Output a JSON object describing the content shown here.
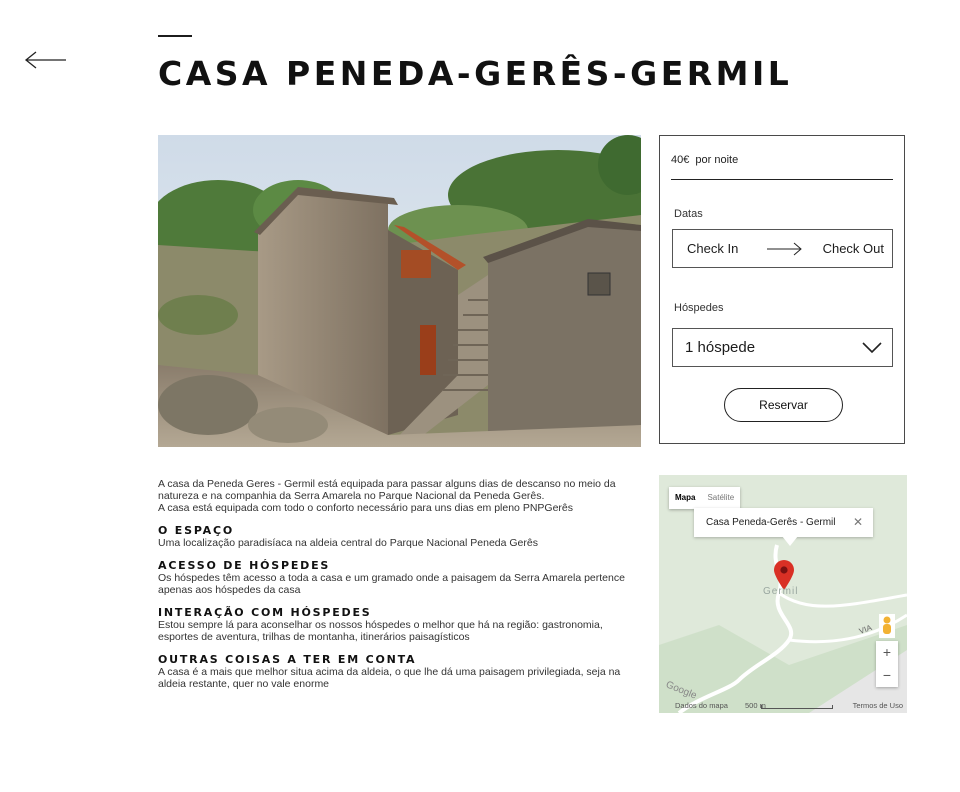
{
  "header": {
    "title": "CASA PENEDA-GERÊS-GERMIL"
  },
  "booking": {
    "price": "40€",
    "price_suffix": "por noite",
    "dates_label": "Datas",
    "check_in": "Check In",
    "check_out": "Check Out",
    "guests_label": "Hóspedes",
    "guests_value": "1 hóspede",
    "reserve_label": "Reservar"
  },
  "description": {
    "intro": "A casa da Peneda Geres - Germil está equipada para passar alguns dias de descanso no meio da natureza e na companhia da Serra Amarela no Parque Nacional da Peneda Gerês.",
    "intro2": "A casa está equipada com todo o conforto necessário para uns dias em pleno PNPGerês",
    "sections": [
      {
        "title": "O ESPAÇO",
        "text": "Uma localização paradisíaca na aldeia central do Parque Nacional Peneda Gerês"
      },
      {
        "title": "ACESSO DE HÓSPEDES",
        "text": "Os hóspedes têm acesso a toda a casa e um gramado onde a paisagem da Serra Amarela pertence apenas aos hóspedes da casa"
      },
      {
        "title": "INTERAÇÃO COM HÓSPEDES",
        "text": "Estou sempre lá para aconselhar os nossos hóspedes o melhor que há na região: gastronomia, esportes de aventura, trilhas de montanha, itinerários paisagísticos"
      },
      {
        "title": "OUTRAS COISAS A TER EM CONTA",
        "text": "A casa é a mais que melhor situa acima da aldeia, o que lhe dá uma paisagem privilegiada, seja na aldeia restante, quer no vale enorme"
      }
    ]
  },
  "map": {
    "tab_map": "Mapa",
    "tab_satellite": "Satélite",
    "info_title": "Casa Peneda-Gerês - Germil",
    "place_label": "Germil",
    "road_label": "VIA",
    "footer_data": "Dados do mapa",
    "footer_scale": "500 m",
    "footer_terms": "Termos de Uso",
    "zoom_in": "+",
    "zoom_out": "−",
    "watermark": "Google"
  },
  "colors": {
    "text": "#1c1c1c",
    "map_bg": "#dde9d8",
    "pin": "#d93025"
  },
  "icons": {
    "back": "left-arrow-icon",
    "dates_arrow": "right-arrow-icon",
    "select": "chevron-down-icon",
    "pin": "map-pin-icon",
    "pegman": "street-view-pegman-icon",
    "close": "close-icon"
  }
}
